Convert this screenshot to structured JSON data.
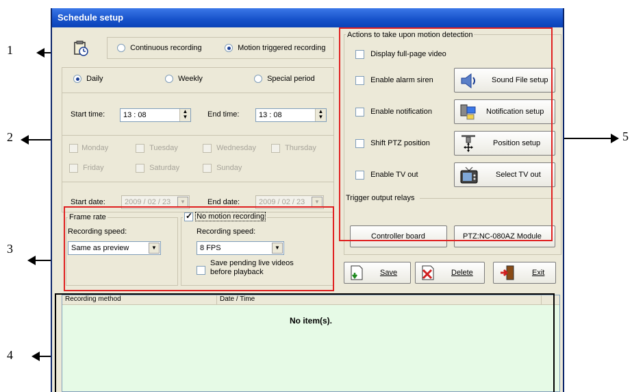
{
  "window": {
    "title": "Schedule setup"
  },
  "mode": {
    "continuous_label": "Continuous recording",
    "motion_label": "Motion triggered recording",
    "selected": "motion"
  },
  "period": {
    "daily": "Daily",
    "weekly": "Weekly",
    "special": "Special period",
    "selected": "daily"
  },
  "time": {
    "start_label": "Start time:",
    "start_value": "13 : 08",
    "end_label": "End time:",
    "end_value": "13 : 08"
  },
  "weekdays": [
    "Monday",
    "Tuesday",
    "Wednesday",
    "Thursday",
    "Friday",
    "Saturday",
    "Sunday"
  ],
  "date": {
    "start_label": "Start date:",
    "start_value": "2009 / 02 / 23",
    "end_label": "End date:",
    "end_value": "2009 / 02 / 23"
  },
  "frame_rate": {
    "title": "Frame rate",
    "speed_label": "Recording speed:",
    "speed_value": "Same as preview"
  },
  "no_motion": {
    "title": "No motion recording",
    "checked": true,
    "speed_label": "Recording speed:",
    "speed_value": "8   FPS",
    "save_pending_line1": "Save pending live videos",
    "save_pending_line2": "before playback"
  },
  "actions": {
    "title": "Actions to take upon motion detection",
    "display_full": "Display full-page video",
    "alarm": "Enable alarm siren",
    "sound_button": "Sound File setup",
    "notification": "Enable notification",
    "notification_button": "Notification setup",
    "ptz": "Shift PTZ position",
    "position_button": "Position setup",
    "tv": "Enable TV out",
    "tv_button": "Select TV out"
  },
  "relays": {
    "title": "Trigger output relays",
    "controller": "Controller board",
    "ptz_module": "PTZ:NC-080AZ Module"
  },
  "buttons": {
    "save": "Save",
    "delete": "Delete",
    "exit": "Exit"
  },
  "list": {
    "col_method": "Recording method",
    "col_date": "Date / Time",
    "empty": "No item(s).",
    "bg_color": "#e6fae6"
  },
  "callouts": [
    "1",
    "2",
    "3",
    "4",
    "5"
  ],
  "colors": {
    "highlight": "#e02020",
    "title_bar": "#1651c9"
  }
}
